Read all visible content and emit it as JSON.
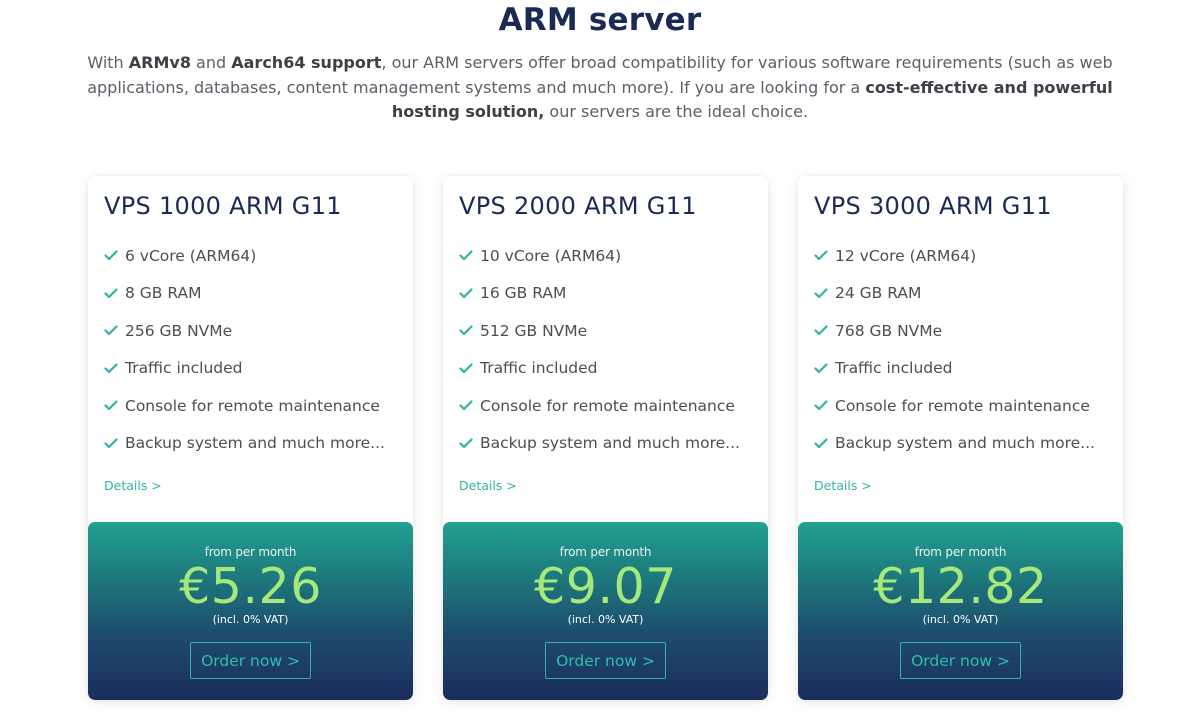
{
  "page": {
    "title": "ARM server",
    "intro": {
      "t1": "With ",
      "b1": "ARMv8",
      "t2": " and ",
      "b2": "Aarch64 support",
      "t3": ", our ARM servers offer broad compatibility for various software requirements (such as web applications, databases, content management systems and much more). If you are looking for a ",
      "b3": "cost-effective and powerful hosting solution,",
      "t4": " our servers are the ideal choice."
    }
  },
  "colors": {
    "title": "#1a2a54",
    "accent_teal": "#2fb3a3",
    "price_green": "#a6e87a",
    "panel_top": "#23a091",
    "panel_bottom": "#1c2d5c"
  },
  "icons": {
    "feature_check": "check-icon"
  },
  "plans": [
    {
      "name": "VPS 1000 ARM G11",
      "features": [
        "6 vCore (ARM64)",
        "8 GB RAM",
        "256 GB NVMe",
        "Traffic included",
        "Console for remote maintenance",
        "Backup system and much more..."
      ],
      "details_label": "Details >",
      "price_from": "from per month",
      "price": "€5.26",
      "vat_note": "(incl. 0% VAT)",
      "order_label": "Order now >"
    },
    {
      "name": "VPS 2000 ARM G11",
      "features": [
        "10 vCore (ARM64)",
        "16 GB RAM",
        "512 GB NVMe",
        "Traffic included",
        "Console for remote maintenance",
        "Backup system and much more..."
      ],
      "details_label": "Details >",
      "price_from": "from per month",
      "price": "€9.07",
      "vat_note": "(incl. 0% VAT)",
      "order_label": "Order now >"
    },
    {
      "name": "VPS 3000 ARM G11",
      "features": [
        "12 vCore (ARM64)",
        "24 GB RAM",
        "768 GB NVMe",
        "Traffic included",
        "Console for remote maintenance",
        "Backup system and much more..."
      ],
      "details_label": "Details >",
      "price_from": "from per month",
      "price": "€12.82",
      "vat_note": "(incl. 0% VAT)",
      "order_label": "Order now >"
    }
  ]
}
